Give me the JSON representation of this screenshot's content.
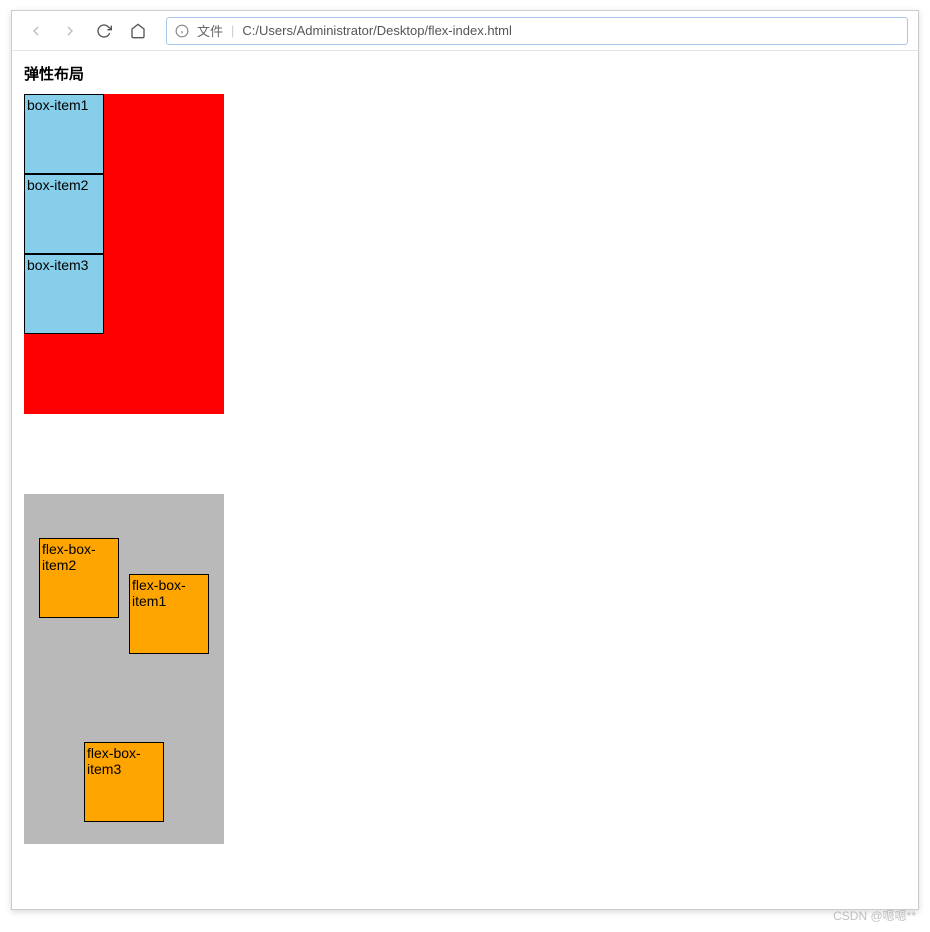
{
  "toolbar": {
    "file_label": "文件",
    "url": "C:/Users/Administrator/Desktop/flex-index.html"
  },
  "page": {
    "title": "弹性布局"
  },
  "box": {
    "items": [
      {
        "label": "box-item1"
      },
      {
        "label": "box-item2"
      },
      {
        "label": "box-item3"
      }
    ]
  },
  "flexbox": {
    "items": [
      {
        "label": "flex-box-item1"
      },
      {
        "label": "flex-box-item2"
      },
      {
        "label": "flex-box-item3"
      }
    ]
  },
  "watermark": "CSDN @嗯嗯**"
}
